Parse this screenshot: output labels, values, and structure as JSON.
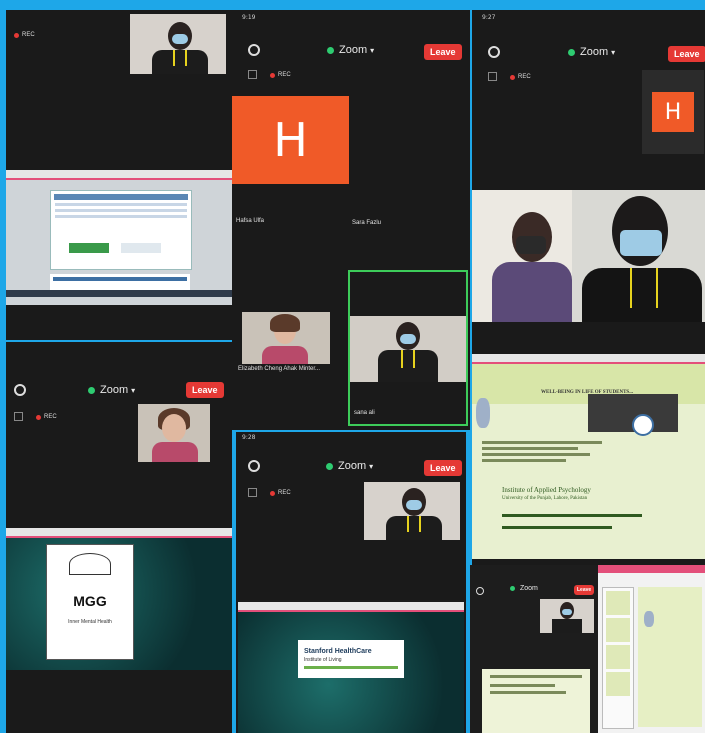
{
  "app": {
    "name": "Zoom",
    "leave_label": "Leave",
    "rec_label": "REC",
    "accent_leave": "#e53935",
    "avatar_color": "#f05a28"
  },
  "screens": {
    "top_left": {
      "rec": "REC"
    },
    "top_center": {
      "status_time": "9:19",
      "avatar_letter": "H",
      "name_1": "Hafsa Ulfa",
      "name_2": "Sara Fazlu",
      "name_3": "Elizabeth Cheng Ahak Minter...",
      "name_4": "sana ali"
    },
    "top_right": {
      "status_time": "9:27",
      "avatar_letter": "H",
      "slide_title": "WELL-BEING IN LIFE OF STUDENTS...",
      "slide_institute": "Institute of Applied Psychology",
      "slide_university": "University of the Punjab, Lahore, Pakistan"
    },
    "mid_left": {
      "slide_line_1": "MGG",
      "slide_line_2": "Inner Mental Health"
    },
    "mid_center": {
      "status_time": "9:28",
      "slide_brand": "Stanford HealthCare",
      "slide_sub": "Institute of Living"
    },
    "bottom_right": {
      "zoom_label": "Zoom"
    }
  }
}
